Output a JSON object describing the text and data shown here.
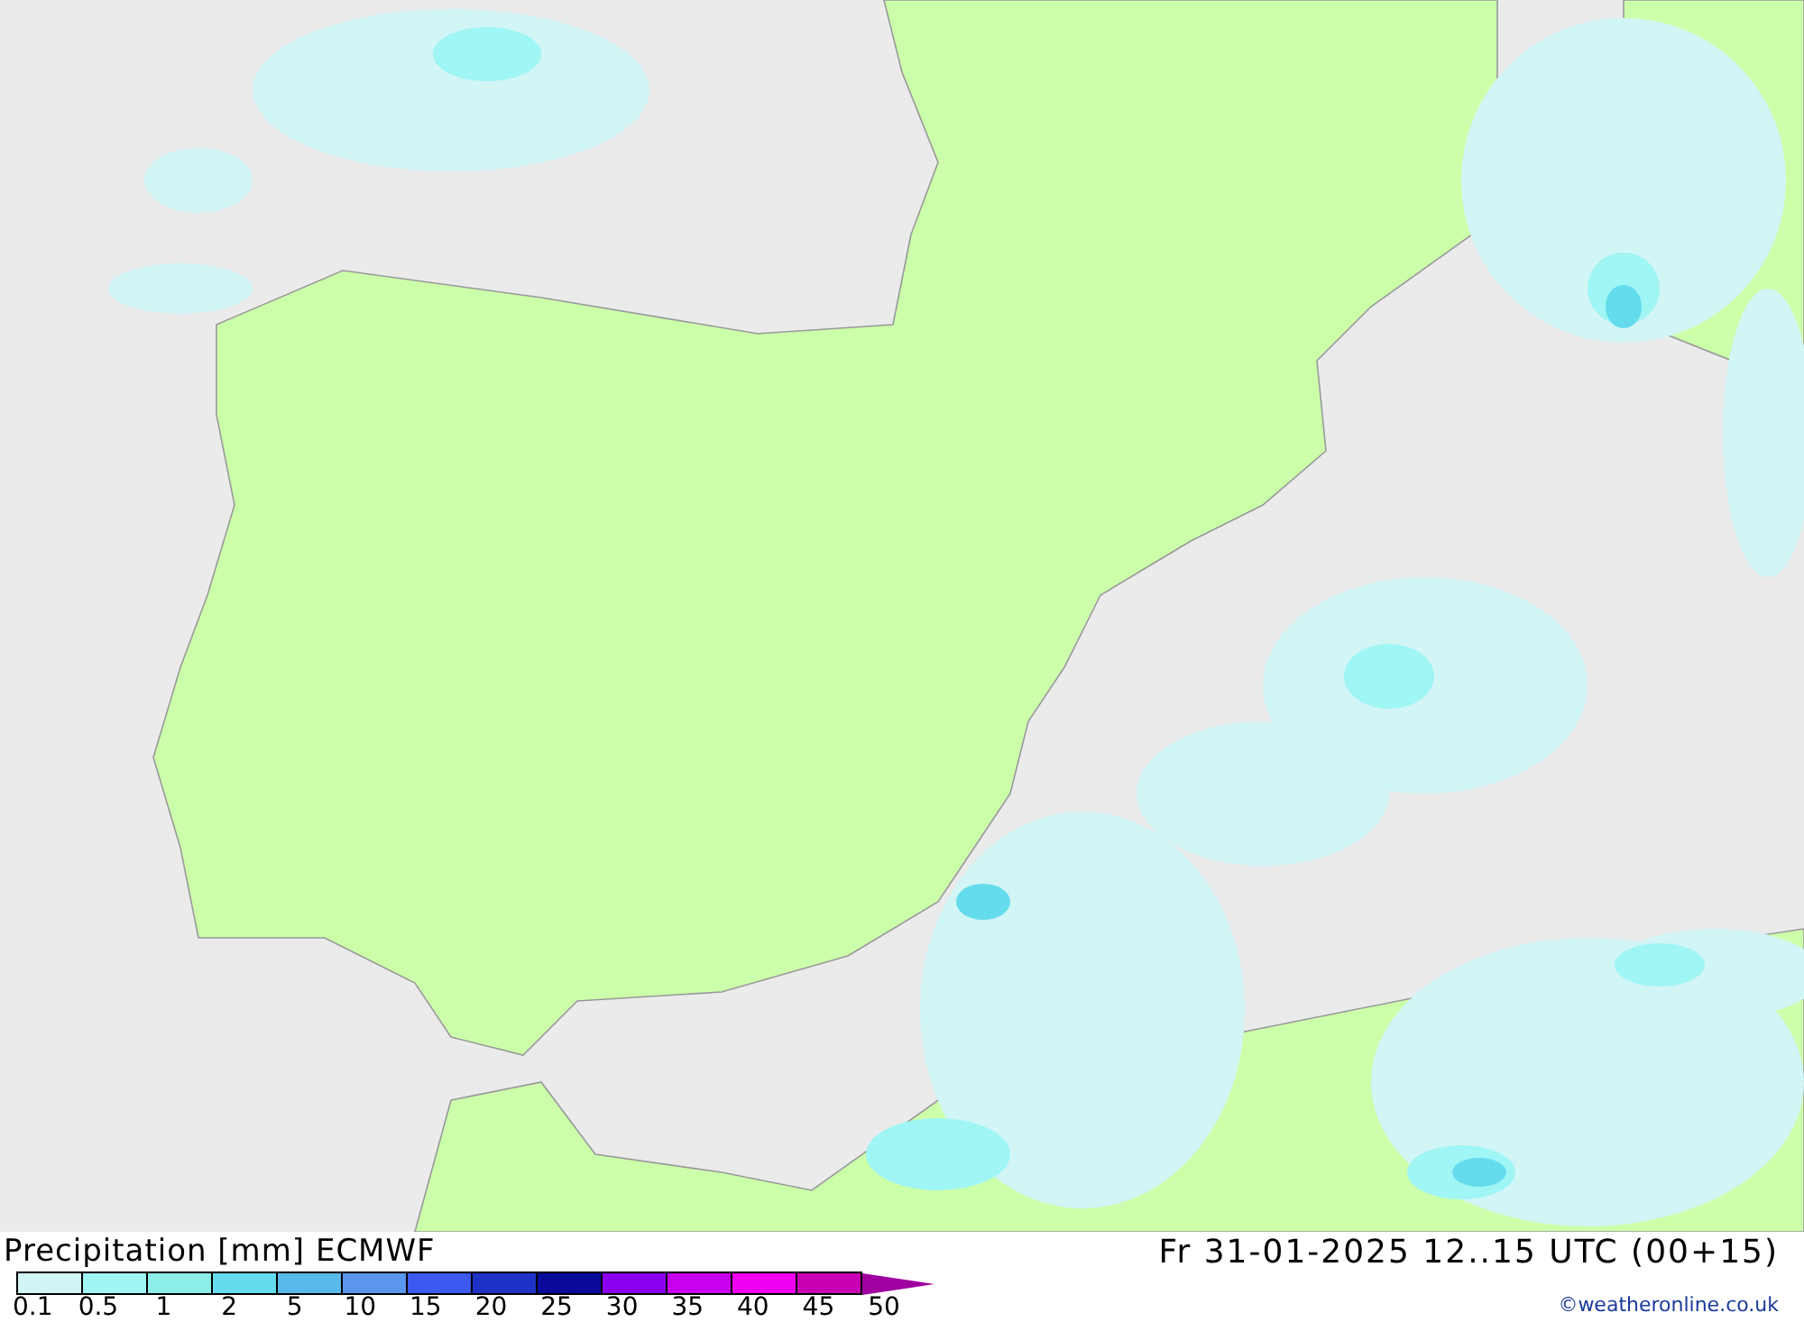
{
  "legend": {
    "title": "Precipitation [mm] ECMWF",
    "swatches": [
      {
        "kind": "box",
        "color": "#d2f5f5"
      },
      {
        "kind": "box",
        "color": "#a0f5f5"
      },
      {
        "kind": "box",
        "color": "#8ceee8"
      },
      {
        "kind": "box",
        "color": "#64dced"
      },
      {
        "kind": "box",
        "color": "#5ab9eb"
      },
      {
        "kind": "box",
        "color": "#5a96eb"
      },
      {
        "kind": "box",
        "color": "#3c5af0"
      },
      {
        "kind": "box",
        "color": "#1e32c8"
      },
      {
        "kind": "box",
        "color": "#0a0a9b"
      },
      {
        "kind": "box",
        "color": "#8c00f0"
      },
      {
        "kind": "box",
        "color": "#c800f0"
      },
      {
        "kind": "box",
        "color": "#f000f0"
      },
      {
        "kind": "box",
        "color": "#c800b4"
      },
      {
        "kind": "arrow",
        "color": "#a000a0"
      }
    ],
    "ticks": [
      "0.1",
      "0.5",
      "1",
      "2",
      "5",
      "10",
      "15",
      "20",
      "25",
      "30",
      "35",
      "40",
      "45",
      "50"
    ]
  },
  "valid_time": "Fr 31-01-2025 12..15 UTC (00+15)",
  "credit": "©weatheronline.co.uk"
}
